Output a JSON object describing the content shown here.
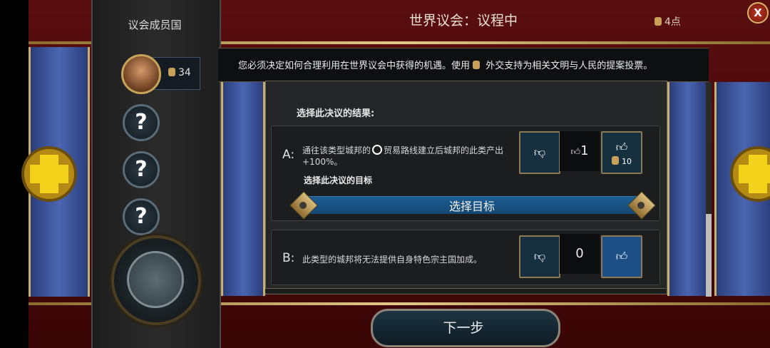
{
  "header": {
    "title": "世界议会：议程中",
    "points": "4点",
    "close_label": "X"
  },
  "sidebar": {
    "title": "议会成员国",
    "player_votes": "34",
    "unknown_members": [
      "?",
      "?",
      "?"
    ]
  },
  "notice": {
    "text_before": "您必须决定如何合理利用在世界议会中获得的机遇。使用",
    "text_after": "外交支持为相关文明与人民的提案投票。"
  },
  "proposal": {
    "section_label": "选择此决议的结果:",
    "option_a": {
      "letter": "A:",
      "desc_before": "通往该类型城邦的",
      "desc_after": "贸易路线建立后城邦的此类产出+100%。",
      "count": "1",
      "upvote_cost": "10",
      "target_label": "选择此决议的目标",
      "target_button": "选择目标"
    },
    "option_b": {
      "letter": "B:",
      "desc": "此类型的城邦将无法提供自身特色宗主国加成。",
      "count": "0"
    }
  },
  "footer": {
    "next_label": "下一步"
  },
  "colors": {
    "accent_gold": "#c8a458",
    "selected_blue": "#1d4f86",
    "background_red": "#5a0e10"
  }
}
